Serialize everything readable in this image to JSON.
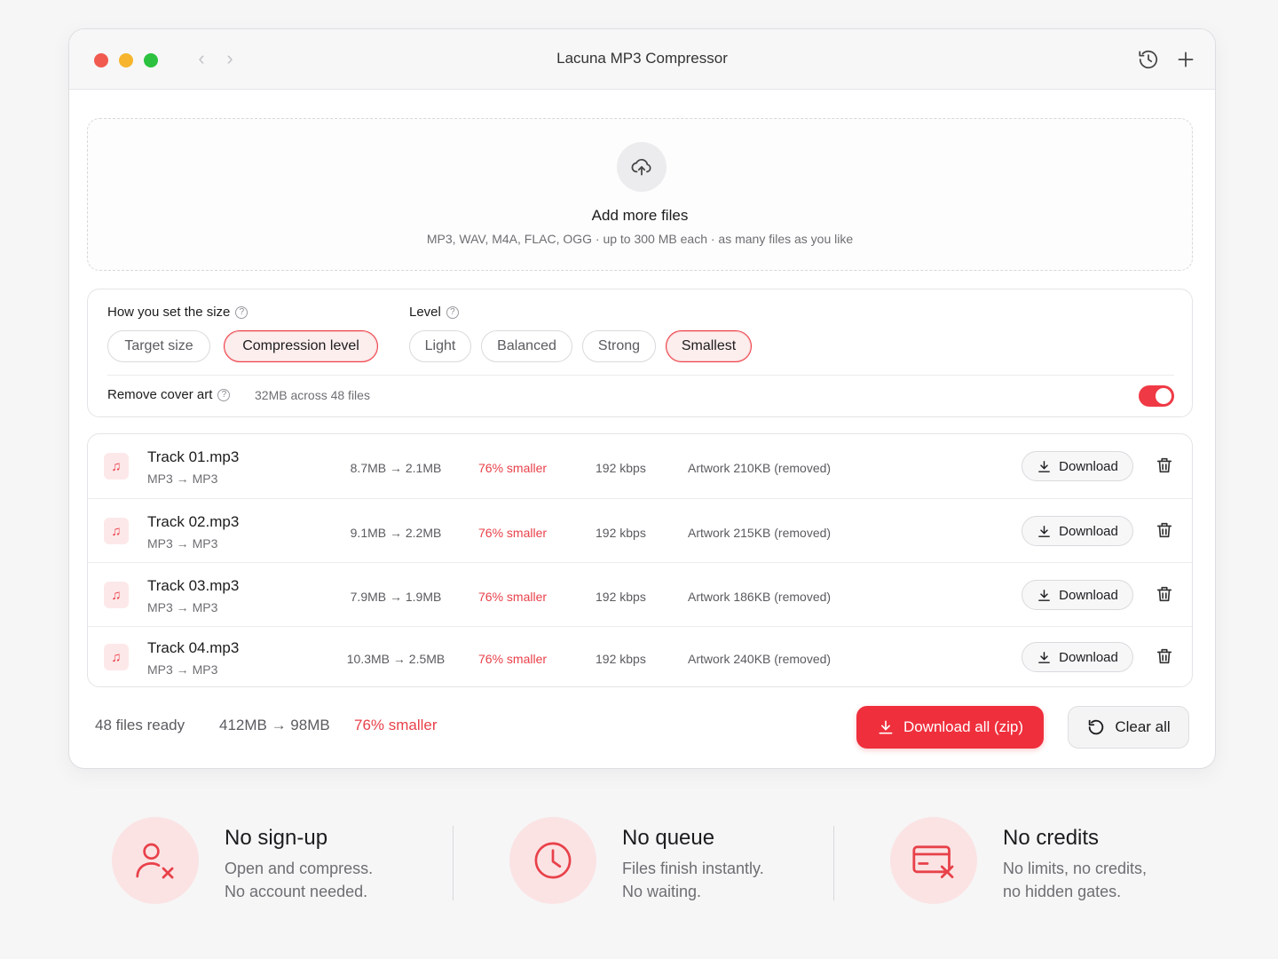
{
  "window": {
    "title": "Lacuna MP3 Compressor",
    "nav_back": "‹",
    "nav_forward": "›"
  },
  "dropzone": {
    "title": "Add more files",
    "subtitle": "MP3, WAV, M4A, FLAC, OGG · up to 300 MB each · as many files as you like"
  },
  "settings": {
    "size_mode_label": "How you set the size",
    "size_modes": [
      "Target size",
      "Compression level"
    ],
    "size_mode_selected": "Compression level",
    "level_label": "Level",
    "levels": [
      "Light",
      "Balanced",
      "Strong",
      "Smallest"
    ],
    "level_selected": "Smallest",
    "cover_art_label": "Remove cover art",
    "cover_art_meta": "32MB across 48 files",
    "cover_art_enabled": true,
    "help_glyph": "?"
  },
  "files": [
    {
      "name": "Track 01.mp3",
      "conversion": "MP3 → MP3",
      "sizes": "8.7MB → 2.1MB",
      "reduction": "76% smaller",
      "bitrate": "192 kbps",
      "artwork": "Artwork 210KB (removed)",
      "download_label": "Download"
    },
    {
      "name": "Track 02.mp3",
      "conversion": "MP3 → MP3",
      "sizes": "9.1MB → 2.2MB",
      "reduction": "76% smaller",
      "bitrate": "192 kbps",
      "artwork": "Artwork 215KB (removed)",
      "download_label": "Download"
    },
    {
      "name": "Track 03.mp3",
      "conversion": "MP3 → MP3",
      "sizes": "7.9MB → 1.9MB",
      "reduction": "76% smaller",
      "bitrate": "192 kbps",
      "artwork": "Artwork 186KB (removed)",
      "download_label": "Download"
    },
    {
      "name": "Track 04.mp3",
      "conversion": "MP3 → MP3",
      "sizes": "10.3MB → 2.5MB",
      "reduction": "76% smaller",
      "bitrate": "192 kbps",
      "artwork": "Artwork 240KB (removed)",
      "download_label": "Download"
    }
  ],
  "summary": {
    "count": "48 files ready",
    "sizes": "412MB → 98MB",
    "reduction": "76% smaller",
    "download_all_label": "Download all (zip)",
    "clear_all_label": "Clear all"
  },
  "features": [
    {
      "title": "No sign-up",
      "line1": "Open and compress.",
      "line2": "No account needed.",
      "icon": "user-x-icon"
    },
    {
      "title": "No queue",
      "line1": "Files finish instantly.",
      "line2": "No waiting.",
      "icon": "clock-icon"
    },
    {
      "title": "No credits",
      "line1": "No limits, no credits,",
      "line2": "no hidden gates.",
      "icon": "card-x-icon"
    }
  ],
  "colors": {
    "accent": "#ef2f3c",
    "accent_soft": "#fbe3e4",
    "text_muted": "#6e6e73"
  }
}
